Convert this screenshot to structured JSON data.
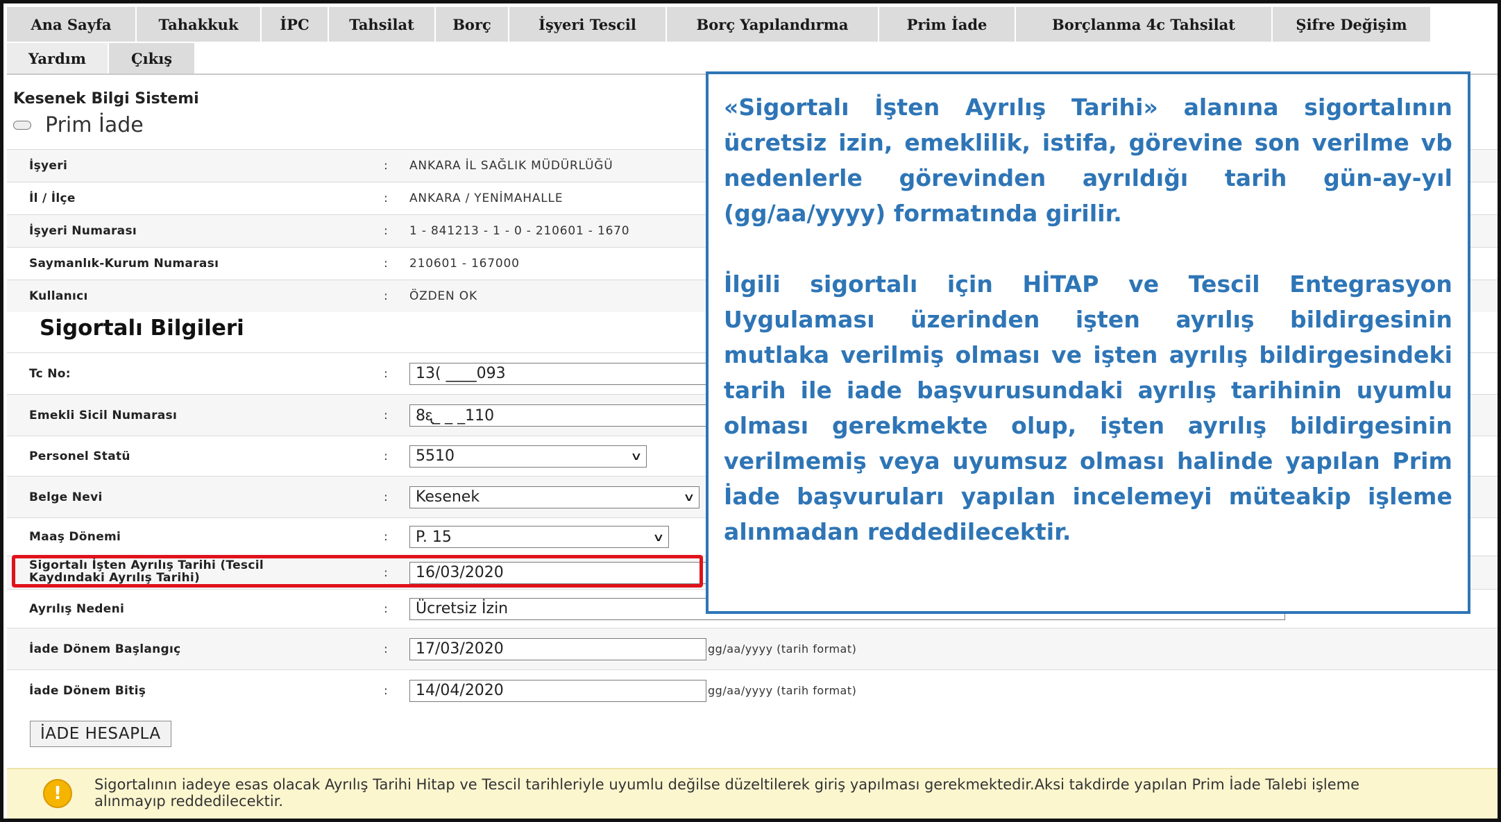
{
  "nav": {
    "row1": [
      "Ana Sayfa",
      "Tahakkuk",
      "İPC",
      "Tahsilat",
      "Borç",
      "İşyeri Tescil",
      "Borç Yapılandırma",
      "Prim İade",
      "Borçlanma 4c Tahsilat",
      "Şifre Değişim"
    ],
    "row2": [
      "Yardım",
      "Çıkış"
    ]
  },
  "header": {
    "system_title": "Kesenek Bilgi Sistemi",
    "page_title": "Prim İade"
  },
  "info": {
    "isyeri": {
      "label": "İşyeri",
      "value": "ANKARA İL SAĞLIK MÜDÜRLÜĞÜ"
    },
    "il_ilce": {
      "label": "İl / İlçe",
      "value": "ANKARA / YENİMAHALLE"
    },
    "isyeri_no": {
      "label": "İşyeri Numarası",
      "value": "1 - 841213 - 1 - 0 - 210601 - 1670"
    },
    "saymanlik": {
      "label": "Saymanlık-Kurum Numarası",
      "value": "210601 - 167000"
    },
    "kullanici": {
      "label": "Kullanıcı",
      "value": "ÖZDEN OK"
    }
  },
  "section_title": "Sigortalı Bilgileri",
  "form": {
    "tc_no": {
      "label": "Tc No:",
      "value": "13(  ____093"
    },
    "emekli_sicil": {
      "label": "Emekli Sicil Numarası",
      "value": "8ᶓ_ _ _110"
    },
    "personel_statu": {
      "label": "Personel Statü",
      "value": "5510"
    },
    "belge_nevi": {
      "label": "Belge Nevi",
      "value": "Kesenek"
    },
    "maas_donemi": {
      "label": "Maaş Dönemi",
      "value": "P. 15"
    },
    "ayrilis_tarihi": {
      "label_line1": "Sigortalı İşten Ayrılış Tarihi (Tescil",
      "label_line2": "Kaydındaki Ayrılış Tarihi)",
      "value": "16/03/2020"
    },
    "ayrilis_nedeni": {
      "label": "Ayrılış Nedeni",
      "value": "Ücretsiz İzin"
    },
    "iade_baslangic": {
      "label": "İade Dönem Başlangıç",
      "value": "17/03/2020",
      "hint": "gg/aa/yyyy (tarih format)"
    },
    "iade_bitis": {
      "label": "İade Dönem Bitiş",
      "value": "14/04/2020",
      "hint": "gg/aa/yyyy (tarih format)"
    }
  },
  "colon": ":",
  "button_label": "İADE HESAPLA",
  "warning": {
    "icon": "warning-icon",
    "text": "Sigortalının iadeye esas olacak Ayrılış Tarihi Hitap ve Tescil tarihleriyle uyumlu değilse düzeltilerek giriş yapılması gerekmektedir.Aksi takdirde yapılan Prim İade Talebi işleme alınmayıp reddedilecektir."
  },
  "callout": {
    "paragraph1": "«Sigortalı İşten Ayrılış Tarihi» alanına sigortalının ücretsiz izin, emeklilik, istifa, görevine son verilme vb nedenlerle görevinden ayrıldığı tarih gün-ay-yıl (gg/aa/yyyy) formatında girilir.",
    "paragraph2": "İlgili sigortalı için HİTAP ve Tescil Entegrasyon Uygulaması üzerinden işten ayrılış bildirgesinin mutlaka verilmiş olması ve işten ayrılış bildirgesindeki tarih ile iade başvurusundaki ayrılış tarihinin uyumlu olması gerekmekte olup, işten ayrılış bildirgesinin verilmemiş veya uyumsuz olması halinde yapılan Prim İade başvuruları yapılan incelemeyi müteakip işleme alınmadan reddedilecektir."
  },
  "colors": {
    "callout_blue": "#2e75b6",
    "highlight_red": "#e0121b",
    "warning_bg": "#fcf6cf",
    "nav_bg": "#dcdcdc"
  }
}
